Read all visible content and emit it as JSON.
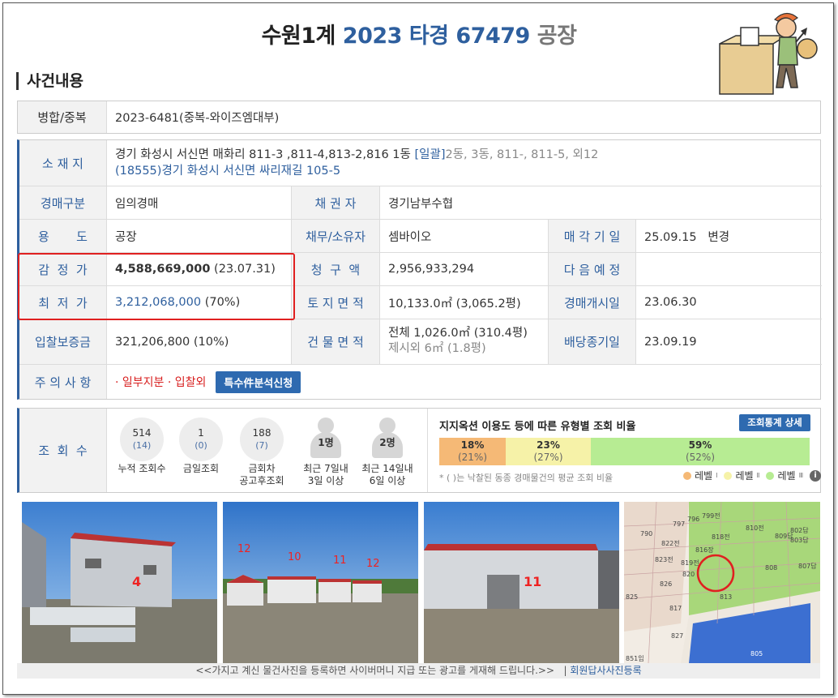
{
  "title": {
    "part1": "수원1계",
    "part2": "2023 타경 67479",
    "part3": "공장"
  },
  "section_heading": "사건내용",
  "merge": {
    "label": "병합/중복",
    "value": "2023-6481(중복-와이즈엠대부)"
  },
  "location": {
    "label": "소  재  지",
    "address": "경기 화성시 서신면 매화리 811-3 ,811-4,813-2,816 1동",
    "bundle_link": "[일괄]",
    "bundle_rest": "2동, 3동, 811-, 811-5, 외12",
    "road_address": "(18555)경기 화성시  서신면 싸리재길  105-5"
  },
  "auction_type": {
    "label": "경매구분",
    "value": "임의경매"
  },
  "creditor": {
    "label": "채  권  자",
    "value": "경기남부수협"
  },
  "usage": {
    "label": "용       도",
    "value": "공장"
  },
  "debtor": {
    "label": "채무/소유자",
    "value": "셈바이오"
  },
  "sale_date": {
    "label": "매 각 기 일",
    "value": "25.09.15   변경"
  },
  "appraisal": {
    "label": "감  정  가",
    "amount": "4,588,669,000",
    "date": "(23.07.31)"
  },
  "claim": {
    "label": "청  구  액",
    "value": "2,956,933,294"
  },
  "next_schedule": {
    "label": "다 음 예 정",
    "value": ""
  },
  "minimum": {
    "label": "최  저  가",
    "amount": "3,212,068,000",
    "pct": "(70%)"
  },
  "land_area": {
    "label": "토 지 면 적",
    "value": "10,133.0㎡ (3,065.2평)"
  },
  "auction_start": {
    "label": "경매개시일",
    "value": "23.06.30"
  },
  "deposit": {
    "label": "입찰보증금",
    "value": "321,206,800 (10%)"
  },
  "building_area": {
    "label": "건 물 면 적",
    "value": "전체 1,026.0㎡ (310.4평)",
    "value2": "제시외 6㎡ (1.8평)"
  },
  "dividend_end": {
    "label": "배당종기일",
    "value": "23.09.19"
  },
  "notes": {
    "label": "주 의 사 항",
    "value": "· 일부지분 · 입찰외",
    "button": "특수件분석신청"
  },
  "views": {
    "label": "조  회  수",
    "stats": [
      {
        "main": "514",
        "sub": "(14)",
        "caption1": "누적 조회수",
        "caption2": ""
      },
      {
        "main": "1",
        "sub": "(0)",
        "caption1": "금일조회",
        "caption2": ""
      },
      {
        "main": "188",
        "sub": "(7)",
        "caption1": "금회차",
        "caption2": "공고후조회"
      },
      {
        "main": "1명",
        "sub": "",
        "caption1": "최근 7일내",
        "caption2": "3일 이상"
      },
      {
        "main": "2명",
        "sub": "",
        "caption1": "최근 14일내",
        "caption2": "6일 이상"
      }
    ]
  },
  "ratio": {
    "title": "지지옥션 이용도 등에 따른 유형별 조회 비율",
    "button": "조회통계 상세",
    "segments": [
      {
        "pct": "18%",
        "sub": "(21%)",
        "color": "#f5b976",
        "share": 18
      },
      {
        "pct": "23%",
        "sub": "(27%)",
        "color": "#f6f2a8",
        "share": 23
      },
      {
        "pct": "59%",
        "sub": "(52%)",
        "color": "#b7ec93",
        "share": 59
      }
    ],
    "note": "* ( )는 낙찰된 동종 경매물건의 평균 조회 비율",
    "legend": [
      {
        "label": "레벨",
        "mark": "Ⅰ",
        "color": "#f5b976"
      },
      {
        "label": "레벨",
        "mark": "Ⅱ",
        "color": "#f6f2a8"
      },
      {
        "label": "레벨",
        "mark": "Ⅲ",
        "color": "#b7ec93"
      }
    ]
  },
  "photos": {
    "photo1_label": "4",
    "photo2_labels": [
      "12",
      "10",
      "11",
      "12"
    ],
    "photo3_label": "11",
    "map_labels": [
      "799전",
      "796",
      "797",
      "790",
      "822전",
      "818전",
      "810전",
      "809답",
      "802답",
      "803답",
      "807답",
      "808",
      "827",
      "826",
      "805",
      "851임",
      "813",
      "816장",
      "825",
      "823전",
      "819전",
      "820",
      "817"
    ]
  },
  "footer": {
    "text": "<<가지고 계신 물건사진을 등록하면 사이버머니 지급 또는 광고를 게재해 드립니다.>>",
    "divider": "|",
    "link": "회원답사사진등록"
  }
}
